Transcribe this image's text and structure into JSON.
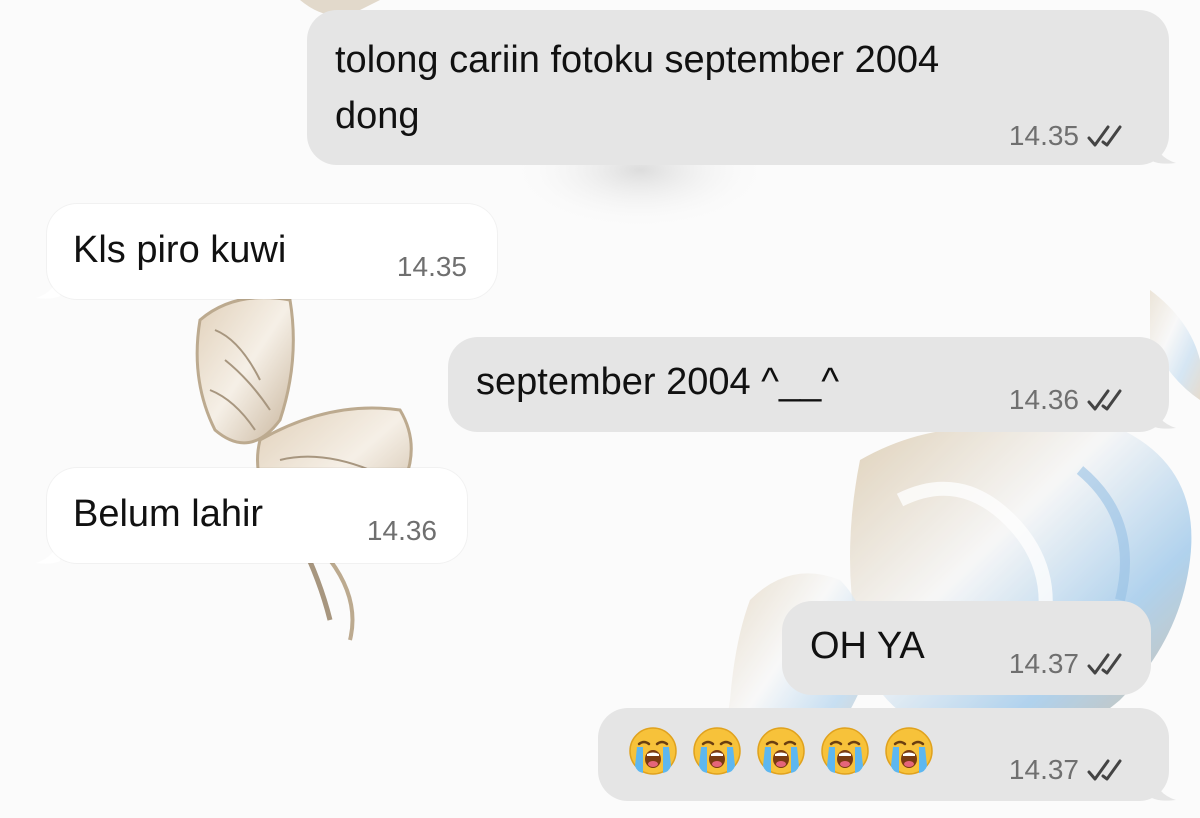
{
  "chat": {
    "messages": [
      {
        "direction": "outgoing",
        "text": "tolong cariin fotoku september 2004\ndong",
        "time": "14.35",
        "status_icon": "double-check-icon"
      },
      {
        "direction": "incoming",
        "text": "Kls piro kuwi",
        "time": "14.35"
      },
      {
        "direction": "outgoing",
        "text": "september 2004 ^__^",
        "time": "14.36",
        "status_icon": "double-check-icon"
      },
      {
        "direction": "incoming",
        "text": "Belum lahir",
        "time": "14.36"
      },
      {
        "direction": "outgoing",
        "text": "OH YA",
        "time": "14.37",
        "status_icon": "double-check-icon"
      },
      {
        "direction": "outgoing",
        "emoji": [
          "loudly-crying-face",
          "loudly-crying-face",
          "loudly-crying-face",
          "loudly-crying-face",
          "loudly-crying-face"
        ],
        "time": "14.37",
        "status_icon": "double-check-icon"
      }
    ]
  },
  "colors": {
    "outgoing_bubble": "#e5e5e5",
    "incoming_bubble": "#ffffff",
    "timestamp": "#6f6f6f",
    "text": "#111111"
  }
}
